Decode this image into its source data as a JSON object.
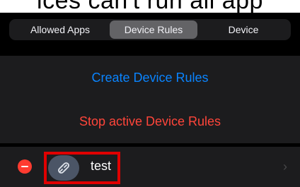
{
  "header": {
    "title_fragment": "ices can't run all app"
  },
  "segmented_control": {
    "tabs": [
      {
        "label": "Allowed Apps"
      },
      {
        "label": "Device Rules"
      },
      {
        "label": "Device"
      }
    ],
    "selected_index": 1
  },
  "actions": {
    "create_label": "Create Device Rules",
    "stop_label": "Stop active Device Rules"
  },
  "rules": [
    {
      "label": "test",
      "icon": "link-icon",
      "delete_icon": "minus-circle-icon",
      "disclosure_icon": "chevron-right-icon"
    }
  ],
  "colors": {
    "create": "#0a84ff",
    "stop": "#ff453a",
    "delete": "#ff3b30",
    "highlight": "#e00000"
  }
}
